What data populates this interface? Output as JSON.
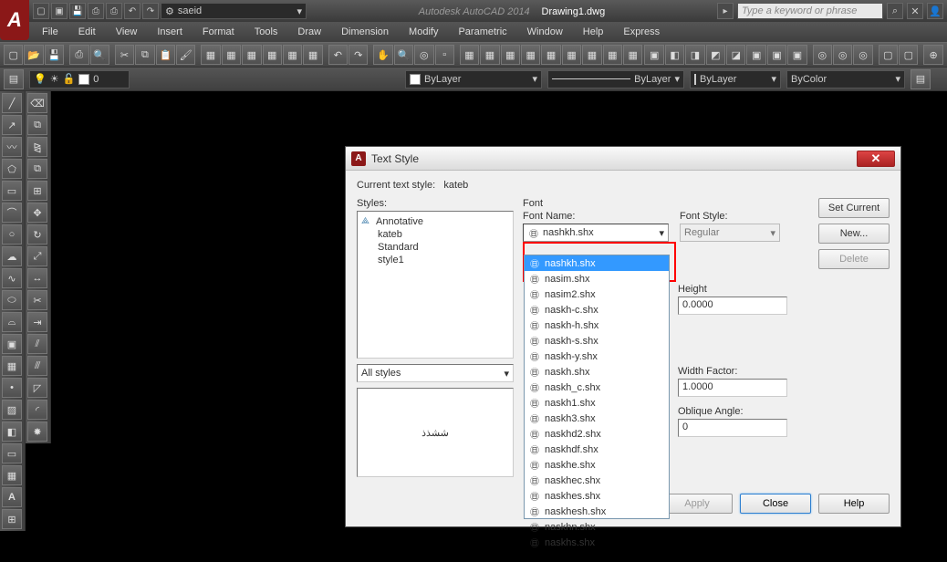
{
  "title": {
    "product": "Autodesk AutoCAD 2014",
    "doc": "Drawing1.dwg",
    "search_ph": "Type a keyword or phrase"
  },
  "workspace": "saeid",
  "menu": [
    "File",
    "Edit",
    "View",
    "Insert",
    "Format",
    "Tools",
    "Draw",
    "Dimension",
    "Modify",
    "Parametric",
    "Window",
    "Help",
    "Express"
  ],
  "layer_ctrl": {
    "layer": "ByLayer",
    "lt": "ByLayer",
    "lw": "ByLayer",
    "color": "ByColor",
    "layer_num": "0"
  },
  "dlg": {
    "title": "Text Style",
    "current_lbl": "Current text style:",
    "current": "kateb",
    "styles_lbl": "Styles:",
    "styles": [
      "Annotative",
      "kateb",
      "Standard",
      "style1"
    ],
    "filter": "All styles",
    "preview": "ششذذ",
    "font_grp": "Font",
    "font_name_lbl": "Font Name:",
    "font_name": "nashkh.shx",
    "font_style_lbl": "Font Style:",
    "font_style": "Regular",
    "height_lbl": "Height",
    "height": "0.0000",
    "wf_lbl": "Width Factor:",
    "wf": "1.0000",
    "oa_lbl": "Oblique Angle:",
    "oa": "0",
    "btn_setcur": "Set Current",
    "btn_new": "New...",
    "btn_del": "Delete",
    "btn_apply": "Apply",
    "btn_close": "Close",
    "btn_help": "Help"
  },
  "font_list": [
    "nashkh.shx",
    "nasim.shx",
    "nasim2.shx",
    "naskh-c.shx",
    "naskh-h.shx",
    "naskh-s.shx",
    "naskh-y.shx",
    "naskh.shx",
    "naskh_c.shx",
    "naskh1.shx",
    "naskh3.shx",
    "naskhd2.shx",
    "naskhdf.shx",
    "naskhe.shx",
    "naskhec.shx",
    "naskhes.shx",
    "naskhesh.shx",
    "naskhn.shx",
    "naskhs.shx"
  ]
}
